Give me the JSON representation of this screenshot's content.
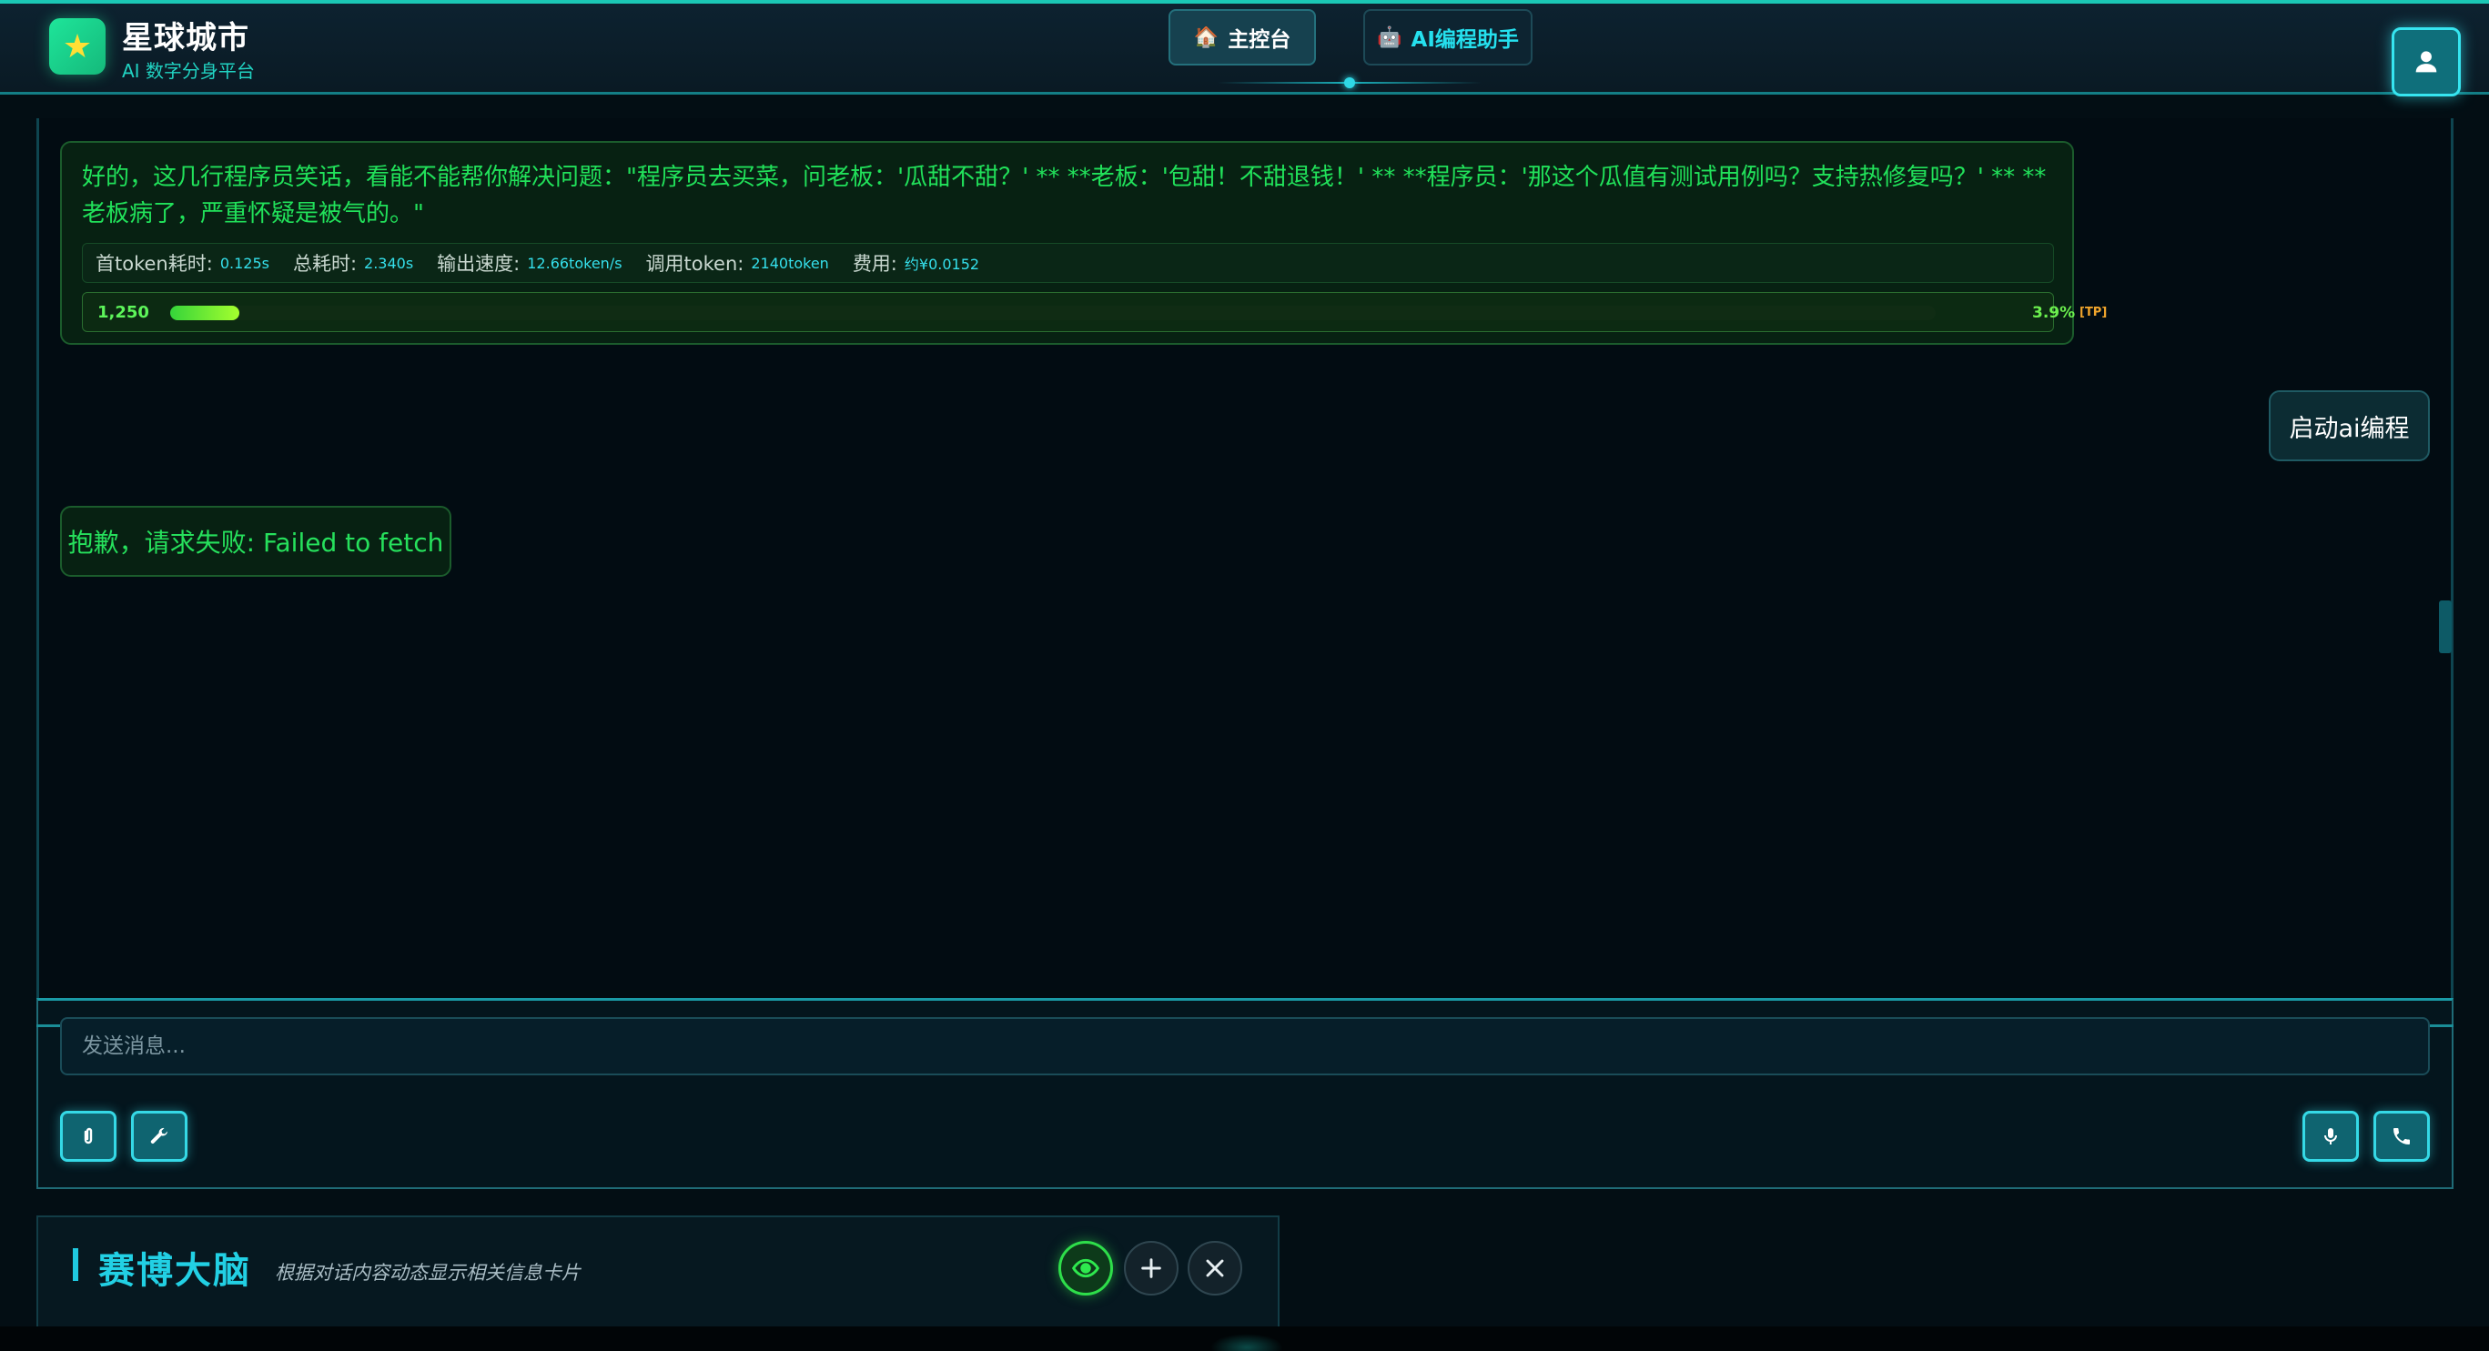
{
  "header": {
    "brand_title": "星球城市",
    "brand_subtitle": "AI 数字分身平台",
    "nav_main_label": "主控台",
    "nav_main_icon": "house-icon",
    "nav_ai_label": "AI编程助手",
    "nav_ai_icon": "robot-icon",
    "user_icon": "user-icon"
  },
  "chat": {
    "messages": [
      {
        "role": "assistant",
        "text": "好的，这几行程序员笑话，看能不能帮你解决问题：\"程序员去买菜，问老板：'瓜甜不甜？' ** **老板：'包甜！不甜退钱！' ** **程序员：'那这个瓜值有测试用例吗？支持热修复吗？' ** **老板病了，严重怀疑是被气的。\"",
        "metrics": {
          "first_token_label": "首token耗时:",
          "first_token_value": "0.125s",
          "total_time_label": "总耗时:",
          "total_time_value": "2.340s",
          "speed_label": "输出速度:",
          "speed_value": "12.66token/s",
          "tokens_label": "调用token:",
          "tokens_value": "2140token",
          "cost_label": "费用:",
          "cost_value": "约¥0.0152"
        },
        "progress": {
          "count": "1,250",
          "percent_label": "3.9%",
          "percent_value": 3.9,
          "tag": "[TP]"
        }
      },
      {
        "role": "user",
        "text": "启动ai编程"
      },
      {
        "role": "assistant",
        "text": "抱歉，请求失败: Failed to fetch"
      }
    ]
  },
  "input": {
    "placeholder": "发送消息...",
    "value": "",
    "left_tools": [
      "paperclip-icon",
      "wrench-icon"
    ],
    "right_tools": [
      "microphone-icon",
      "phone-icon"
    ]
  },
  "brain": {
    "title": "赛博大脑",
    "subtitle": "根据对话内容动态显示相关信息卡片",
    "buttons": [
      "eye-icon",
      "plus-icon",
      "close-icon"
    ]
  },
  "colors": {
    "accent_cyan": "#22d0e4",
    "accent_green": "#21e15a",
    "background": "#030e14"
  }
}
